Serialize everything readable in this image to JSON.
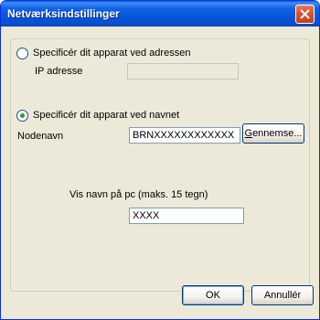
{
  "window": {
    "title": "Netværksindstillinger"
  },
  "options": {
    "by_address": {
      "label": "Specificér dit apparat ved adressen",
      "selected": false
    },
    "ip_label": "IP adresse",
    "ip_value": "",
    "by_name": {
      "label": "Specificér dit apparat ved navnet",
      "selected": true
    },
    "node_label": "Nodenavn",
    "node_value": "BRNXXXXXXXXXXXX",
    "browse_label_prefix": "G",
    "browse_label_rest": "ennemse...",
    "pc_name_label": "Vis navn på pc (maks. 15 tegn)",
    "pc_name_value": "XXXX"
  },
  "buttons": {
    "ok": "OK",
    "cancel": "Annullér"
  },
  "icons": {
    "close": "close-icon"
  }
}
